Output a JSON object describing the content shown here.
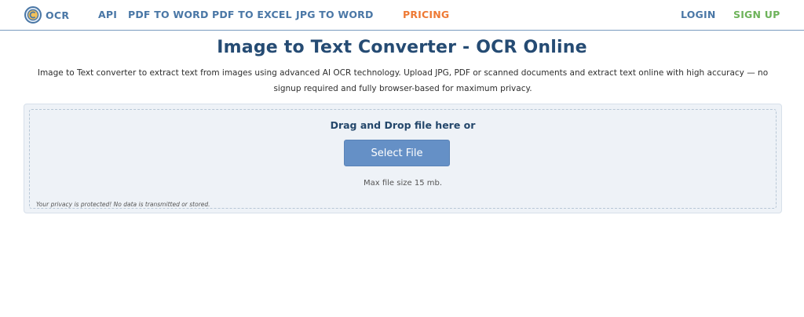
{
  "nav": {
    "logo_text": "OCR",
    "links": [
      "API",
      "PDF TO WORD",
      "PDF TO EXCEL",
      "JPG TO WORD"
    ],
    "pricing": "PRICING",
    "login": "LOGIN",
    "signup": "SIGN UP"
  },
  "main": {
    "title": "Image to Text Converter - OCR Online",
    "subtitle": "Image to Text converter to extract text from images using advanced AI OCR technology. Upload JPG, PDF or scanned documents and extract text online with high accuracy — no signup required and fully browser-based for maximum privacy."
  },
  "upload": {
    "drop_text": "Drag and Drop file here or",
    "button_label": "Select File",
    "max_size": "Max file size 15 mb.",
    "privacy": "Your privacy is protected! No data is transmitted or stored."
  },
  "colors": {
    "nav_link": "#4a77a6",
    "pricing": "#ee7a35",
    "signup": "#6db35a",
    "title": "#254b73",
    "button": "#6590c6"
  }
}
